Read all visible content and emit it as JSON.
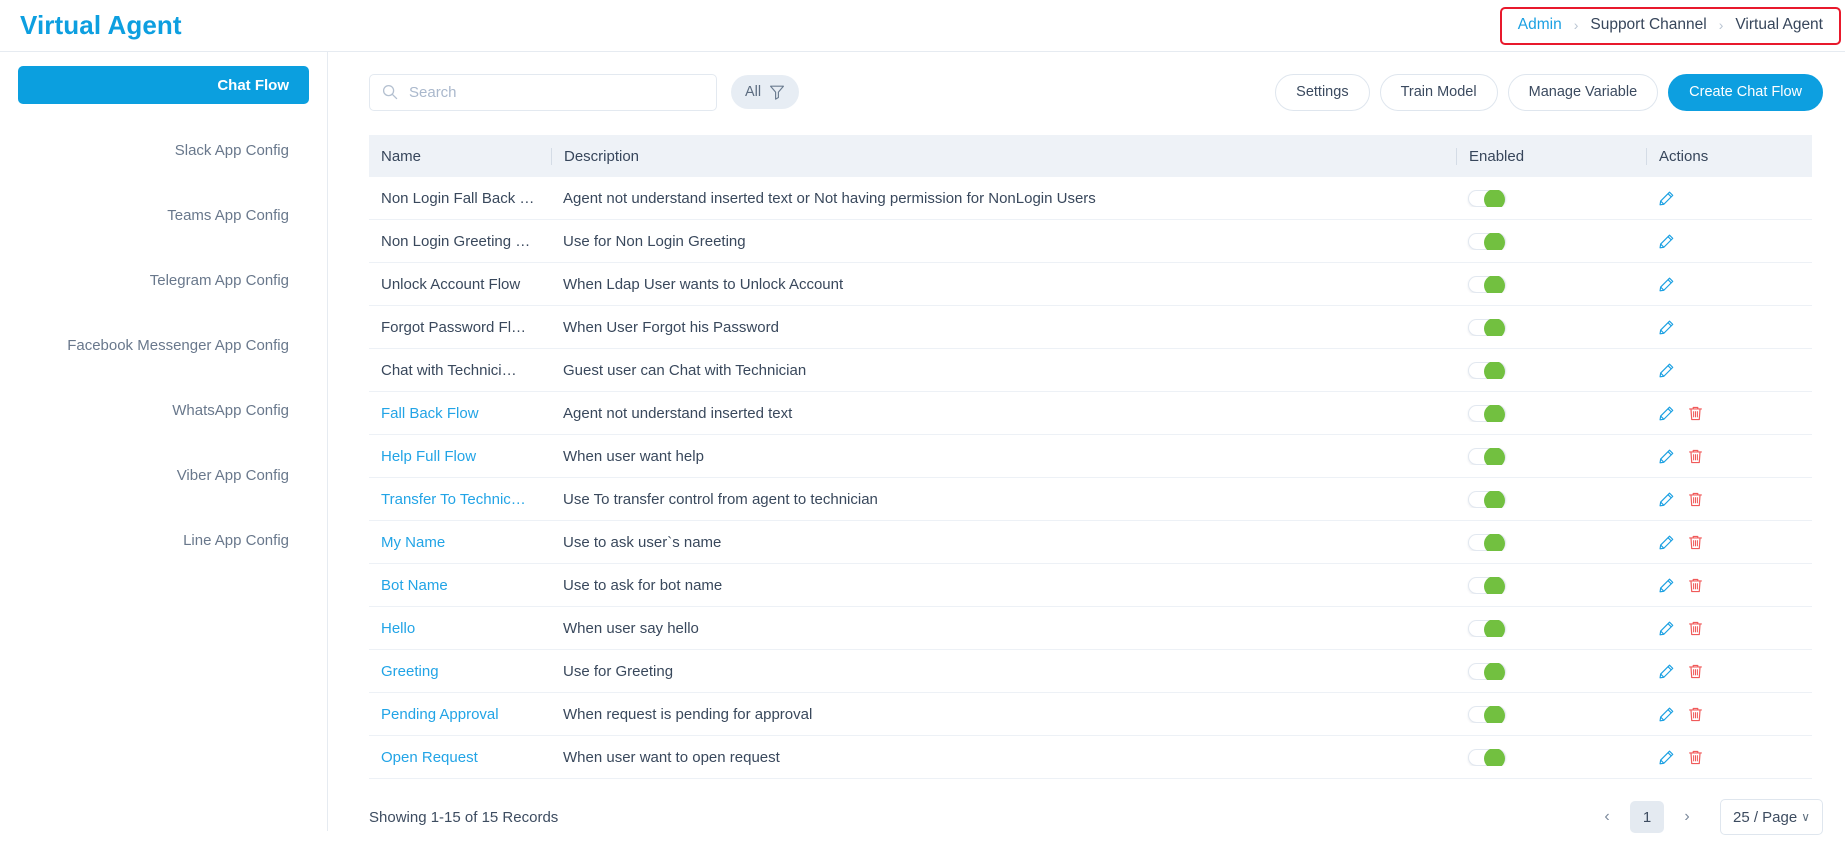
{
  "header": {
    "title": "Virtual Agent",
    "breadcrumb": [
      {
        "label": "Admin",
        "link": true
      },
      {
        "label": "Support Channel",
        "link": false
      },
      {
        "label": "Virtual Agent",
        "link": false
      }
    ],
    "breadcrumb_separator": "›",
    "highlight_color": "#e8192c"
  },
  "sidebar": {
    "items": [
      {
        "label": "Chat Flow",
        "active": true
      },
      {
        "label": "Slack App Config",
        "active": false
      },
      {
        "label": "Teams App Config",
        "active": false
      },
      {
        "label": "Telegram App Config",
        "active": false
      },
      {
        "label": "Facebook Messenger App Config",
        "active": false
      },
      {
        "label": "WhatsApp Config",
        "active": false
      },
      {
        "label": "Viber App Config",
        "active": false
      },
      {
        "label": "Line App Config",
        "active": false
      }
    ],
    "active_color": "#0b9fdf"
  },
  "toolbar": {
    "search": {
      "value": "",
      "placeholder": "Search",
      "icon": "search-icon"
    },
    "filter": {
      "label": "All",
      "icon": "funnel-icon"
    },
    "buttons": [
      {
        "label": "Settings",
        "primary": false
      },
      {
        "label": "Train Model",
        "primary": false
      },
      {
        "label": "Manage Variable",
        "primary": false
      },
      {
        "label": "Create Chat Flow",
        "primary": true
      }
    ],
    "primary_color": "#0d9fe0"
  },
  "table": {
    "columns": [
      "Name",
      "Description",
      "Enabled",
      "Actions"
    ],
    "rows": [
      {
        "name": "Non Login Fall Back …",
        "description": "Agent not understand inserted text or Not having permission for NonLogin Users",
        "enabled": true,
        "name_is_link": false,
        "can_delete": false
      },
      {
        "name": "Non Login Greeting …",
        "description": "Use for Non Login Greeting",
        "enabled": true,
        "name_is_link": false,
        "can_delete": false
      },
      {
        "name": "Unlock Account Flow",
        "description": "When Ldap User wants to Unlock Account",
        "enabled": true,
        "name_is_link": false,
        "can_delete": false
      },
      {
        "name": "Forgot Password Fl…",
        "description": "When User Forgot his Password",
        "enabled": true,
        "name_is_link": false,
        "can_delete": false
      },
      {
        "name": "Chat with Technici…",
        "description": "Guest user can Chat with Technician",
        "enabled": true,
        "name_is_link": false,
        "can_delete": false
      },
      {
        "name": "Fall Back Flow",
        "description": "Agent not understand inserted text",
        "enabled": true,
        "name_is_link": true,
        "can_delete": true
      },
      {
        "name": "Help Full Flow",
        "description": "When user want help",
        "enabled": true,
        "name_is_link": true,
        "can_delete": true
      },
      {
        "name": "Transfer To Technic…",
        "description": "Use To transfer control from agent to technician",
        "enabled": true,
        "name_is_link": true,
        "can_delete": true
      },
      {
        "name": "My Name",
        "description": "Use to ask user`s name",
        "enabled": true,
        "name_is_link": true,
        "can_delete": true
      },
      {
        "name": "Bot Name",
        "description": "Use to ask for bot name",
        "enabled": true,
        "name_is_link": true,
        "can_delete": true
      },
      {
        "name": "Hello",
        "description": "When user say hello",
        "enabled": true,
        "name_is_link": true,
        "can_delete": true
      },
      {
        "name": "Greeting",
        "description": "Use for Greeting",
        "enabled": true,
        "name_is_link": true,
        "can_delete": true
      },
      {
        "name": "Pending Approval",
        "description": "When request is pending for approval",
        "enabled": true,
        "name_is_link": true,
        "can_delete": true
      },
      {
        "name": "Open Request",
        "description": "When user want to open request",
        "enabled": true,
        "name_is_link": true,
        "can_delete": true
      }
    ],
    "toggle_on_color": "#72c040",
    "edit_icon_color": "#1ba0e2",
    "delete_icon_color": "#f05a5a"
  },
  "footer": {
    "records_text": "Showing 1-15 of 15 Records",
    "prev_label": "‹",
    "next_label": "›",
    "current_page": "1",
    "page_size": "25 / Page",
    "page_size_caret": "∨"
  }
}
